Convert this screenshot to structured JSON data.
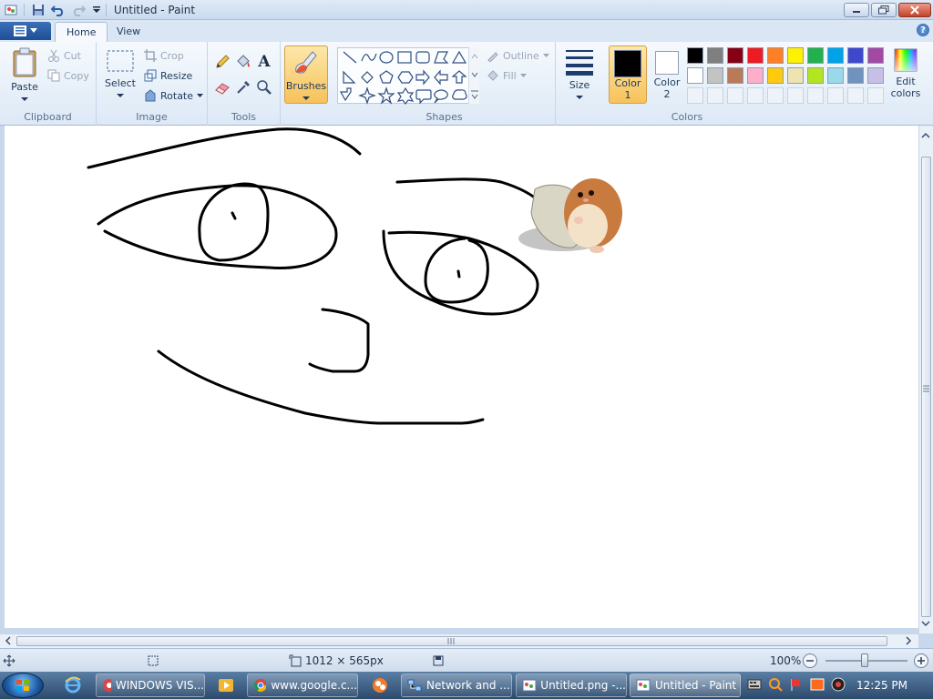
{
  "window": {
    "title": "Untitled - Paint"
  },
  "tabs": [
    {
      "label": "Home"
    },
    {
      "label": "View"
    }
  ],
  "ribbon": {
    "clipboard": {
      "label": "Clipboard",
      "paste": "Paste",
      "cut": "Cut",
      "copy": "Copy"
    },
    "image": {
      "label": "Image",
      "select": "Select",
      "crop": "Crop",
      "resize": "Resize",
      "rotate": "Rotate"
    },
    "tools": {
      "label": "Tools",
      "text_glyph": "A"
    },
    "brushes": {
      "label": "Brushes"
    },
    "shapes": {
      "label": "Shapes",
      "outline": "Outline",
      "fill": "Fill"
    },
    "size": {
      "label": "Size"
    },
    "colors": {
      "label": "Colors",
      "color1_a": "Color",
      "color1_b": "1",
      "color2_a": "Color",
      "color2_b": "2",
      "edit_a": "Edit",
      "edit_b": "colors",
      "color1_value": "#000000",
      "color2_value": "#ffffff",
      "palette_row1": [
        "#000000",
        "#7f7f7f",
        "#880015",
        "#ed1c24",
        "#ff7f27",
        "#fff200",
        "#22b14c",
        "#00a2e8",
        "#3f48cc",
        "#a349a4"
      ],
      "palette_row2": [
        "#ffffff",
        "#c3c3c3",
        "#b97a57",
        "#ffaec9",
        "#ffc90e",
        "#efe4b0",
        "#b5e61d",
        "#99d9ea",
        "#7092be",
        "#c8bfe7"
      ]
    }
  },
  "status": {
    "dimensions": "1012 × 565px",
    "zoom": "100%"
  },
  "taskbar": {
    "items": [
      {
        "label": "WINDOWS VIS..."
      },
      {
        "label": "www.google.c..."
      },
      {
        "label": "Network and ..."
      },
      {
        "label": "Untitled.png -..."
      },
      {
        "label": "Untitled - Paint"
      }
    ],
    "clock": "12:25 PM"
  }
}
